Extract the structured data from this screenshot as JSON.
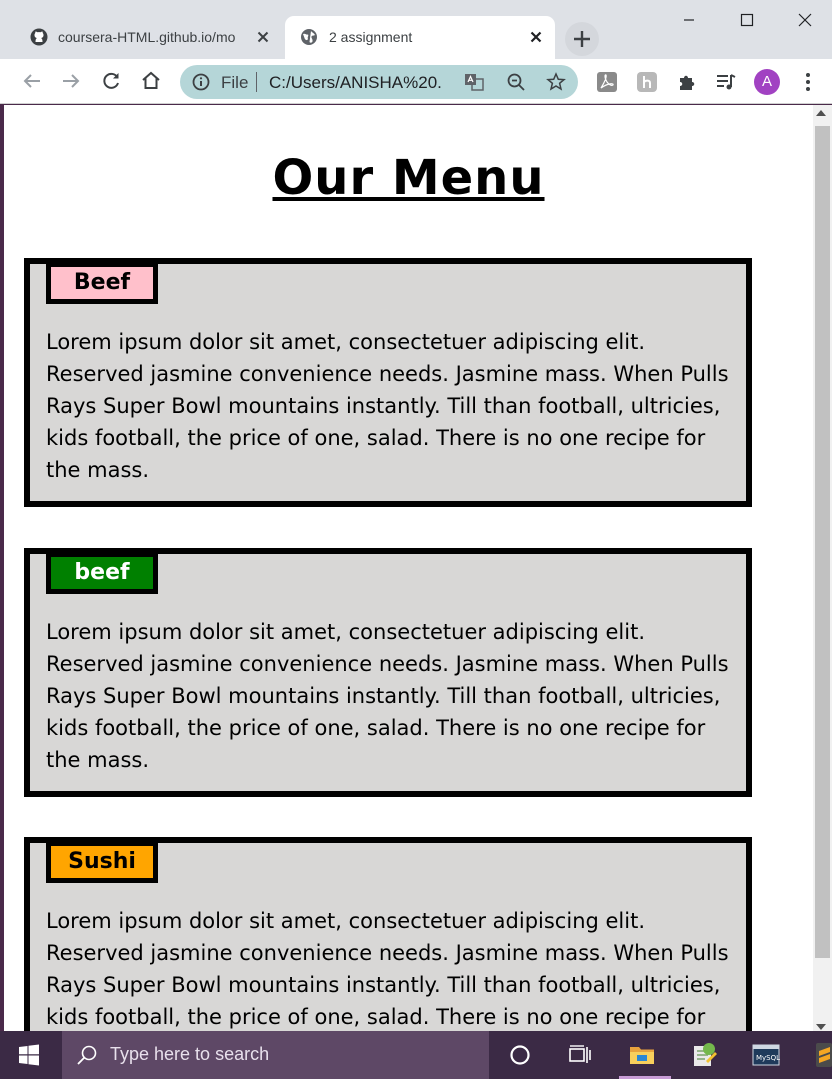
{
  "browser": {
    "tabs": [
      {
        "title": "coursera-HTML.github.io/mo",
        "active": false
      },
      {
        "title": "2 assignment",
        "active": true
      }
    ],
    "address_prefix": "File",
    "address": "C:/Users/ANISHA%20...",
    "profile_initial": "A"
  },
  "page": {
    "title": "Our Menu",
    "cards": [
      {
        "label": "Beef",
        "label_color": "#ffc0cb",
        "text": "Lorem ipsum dolor sit amet, consectetuer adipiscing elit. Reserved jasmine convenience needs. Jasmine mass. When Pulls Rays Super Bowl mountains instantly. Till than football, ultricies, kids football, the price of one, salad. There is no one recipe for the mass."
      },
      {
        "label": "beef",
        "label_color": "#008000",
        "text": "Lorem ipsum dolor sit amet, consectetuer adipiscing elit. Reserved jasmine convenience needs. Jasmine mass. When Pulls Rays Super Bowl mountains instantly. Till than football, ultricies, kids football, the price of one, salad. There is no one recipe for the mass."
      },
      {
        "label": "Sushi",
        "label_color": "#ffa500",
        "text": "Lorem ipsum dolor sit amet, consectetuer adipiscing elit. Reserved jasmine convenience needs. Jasmine mass. When Pulls Rays Super Bowl mountains instantly. Till than football, ultricies, kids football, the price of one, salad. There is no one recipe for the mass."
      }
    ]
  },
  "taskbar": {
    "search_placeholder": "Type here to search"
  },
  "icons": [
    "github-icon",
    "globe-icon",
    "close-icon",
    "plus-icon",
    "minimize-icon",
    "maximize-icon",
    "back-icon",
    "forward-icon",
    "reload-icon",
    "home-icon",
    "info-icon",
    "translate-icon",
    "zoom-icon",
    "star-icon",
    "pdf-icon",
    "extension-icon",
    "puzzle-icon",
    "media-icon",
    "menu-icon",
    "windows-icon",
    "search-icon",
    "cortana-icon",
    "task-view-icon",
    "file-explorer-icon",
    "notepad-icon",
    "mysql-icon",
    "sublime-icon"
  ]
}
